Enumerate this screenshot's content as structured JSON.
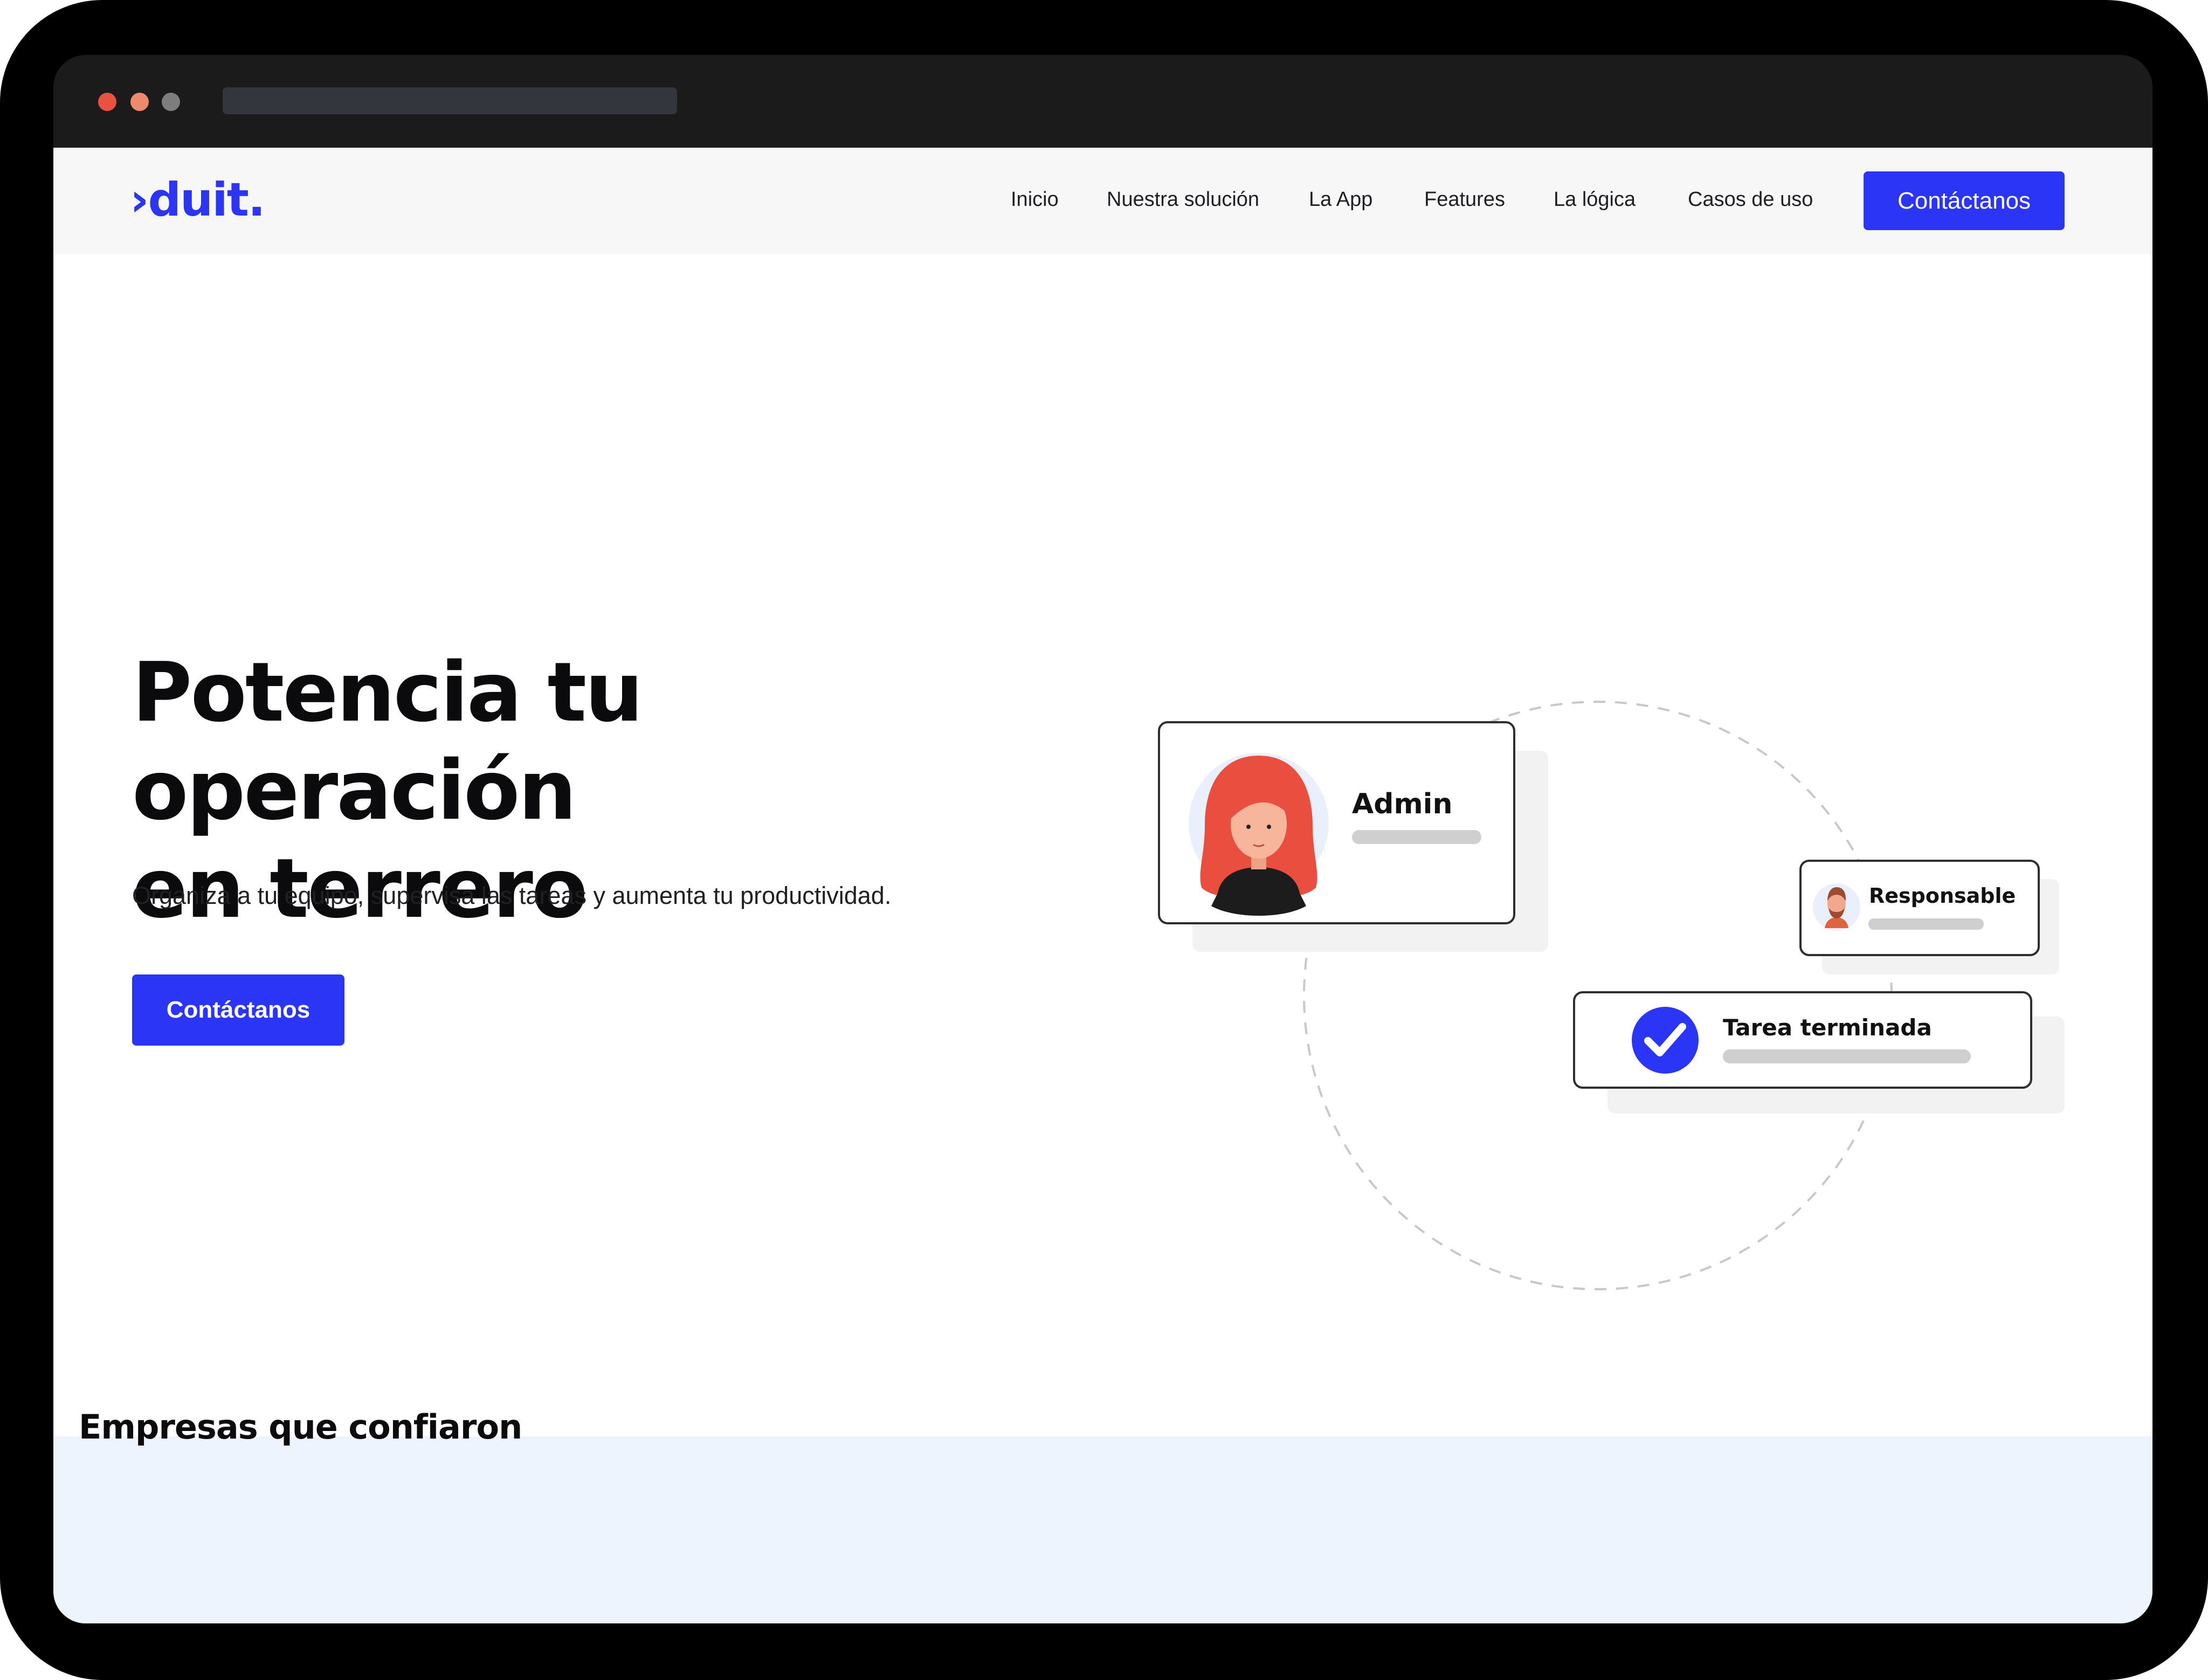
{
  "brand": {
    "logo_text": "›duit.",
    "accent_color": "#2b35f5"
  },
  "nav": {
    "links": [
      "Inicio",
      "Nuestra solución",
      "La App",
      "Features",
      "La lógica",
      "Casos de uso"
    ],
    "cta_label": "Contáctanos"
  },
  "hero": {
    "title_line1": "Potencia tu operación",
    "title_line2": "en terrero",
    "subtitle": "Organiza a tu equipo, supervisa las tareas y aumenta tu productividad.",
    "cta_label": "Contáctanos"
  },
  "illustration": {
    "admin_label": "Admin",
    "responsable_label": "Responsable",
    "task_label": "Tarea terminada",
    "check_icon": "check-icon"
  },
  "companies": {
    "title": "Empresas que confiaron"
  }
}
